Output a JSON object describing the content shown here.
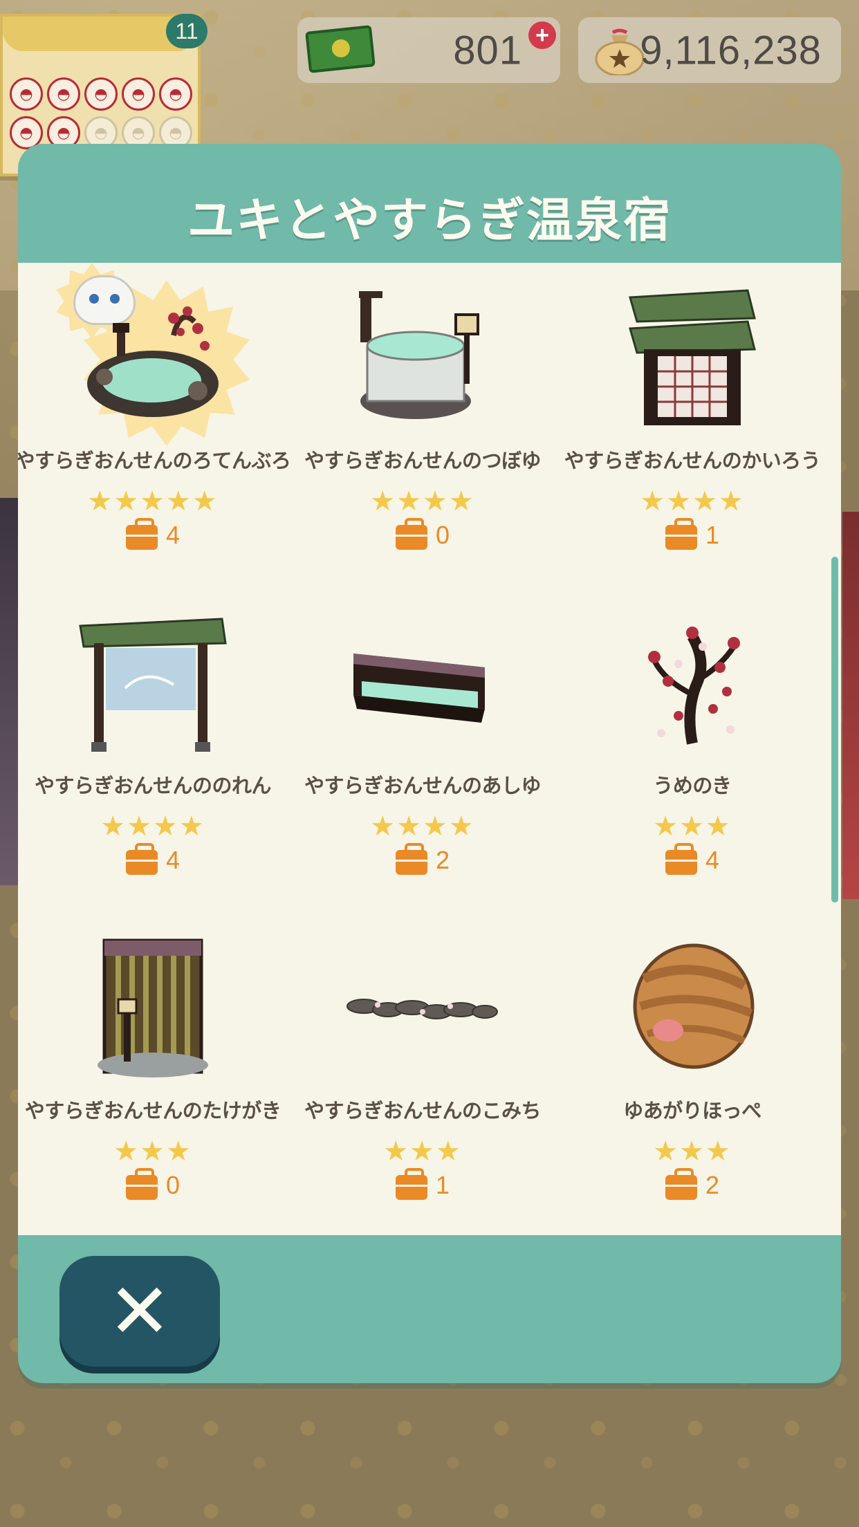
{
  "hud": {
    "stamp_badge": "11",
    "stamps_filled": 7,
    "stamps_total": 10,
    "tickets": "801",
    "bells": "9,116,238"
  },
  "dialog": {
    "title": "ユキとやすらぎ温泉宿",
    "items": [
      {
        "name": "やすらぎおんせんのろてんぶろ",
        "stars": "★★★★★",
        "count": "4",
        "icon": "open-air-bath-icon",
        "featured": true
      },
      {
        "name": "やすらぎおんせんのつぼゆ",
        "stars": "★★★★",
        "count": "0",
        "icon": "pot-bath-icon"
      },
      {
        "name": "やすらぎおんせんのかいろう",
        "stars": "★★★★",
        "count": "1",
        "icon": "corridor-gate-icon"
      },
      {
        "name": "やすらぎおんせんののれん",
        "stars": "★★★★",
        "count": "4",
        "icon": "noren-gate-icon"
      },
      {
        "name": "やすらぎおんせんのあしゆ",
        "stars": "★★★★",
        "count": "2",
        "icon": "foot-bath-icon"
      },
      {
        "name": "うめのき",
        "stars": "★★★",
        "count": "4",
        "icon": "plum-tree-icon"
      },
      {
        "name": "やすらぎおんせんのたけがき",
        "stars": "★★★",
        "count": "0",
        "icon": "bamboo-fence-icon"
      },
      {
        "name": "やすらぎおんせんのこみち",
        "stars": "★★★",
        "count": "1",
        "icon": "stepping-path-icon"
      },
      {
        "name": "ゆあがりほっぺ",
        "stars": "★★★",
        "count": "2",
        "icon": "flushed-cheeks-icon"
      }
    ]
  },
  "colors": {
    "teal": "#71b9a8",
    "panel": "#f7f5e8",
    "star": "#f4c84a",
    "bag": "#e98a27",
    "close_button": "#235564"
  }
}
